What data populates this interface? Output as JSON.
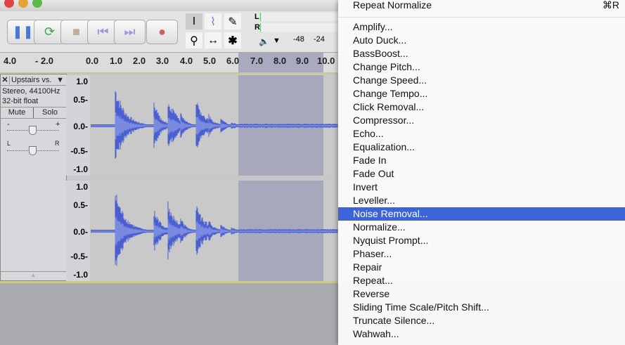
{
  "toolbar": {
    "buttons": [
      "pause",
      "loop",
      "stop",
      "skip-start",
      "skip-end",
      "record"
    ],
    "meter_labels": {
      "l": "L",
      "r": "R"
    },
    "meter_ticks": [
      "-48",
      "-24"
    ]
  },
  "ruler": {
    "ticks": [
      "4.0",
      "- 2.0",
      "0.0",
      "1.0",
      "2.0",
      "3.0",
      "4.0",
      "5.0",
      "6.0",
      "7.0",
      "8.0",
      "9.0",
      "10.0"
    ]
  },
  "track": {
    "name": "Upstairs vs.",
    "rate": "Stereo, 44100Hz",
    "format": "32-bit float",
    "mute": "Mute",
    "solo": "Solo",
    "gain_min": "-",
    "gain_max": "+",
    "pan_l": "L",
    "pan_r": "R",
    "scale": [
      "1.0",
      "0.5-",
      "0.0-",
      "-0.5-",
      "-1.0"
    ]
  },
  "menu": {
    "repeat": "Repeat Normalize",
    "repeat_shortcut": "⌘R",
    "items": [
      "Amplify...",
      "Auto Duck...",
      "BassBoost...",
      "Change Pitch...",
      "Change Speed...",
      "Change Tempo...",
      "Click Removal...",
      "Compressor...",
      "Echo...",
      "Equalization...",
      "Fade In",
      "Fade Out",
      "Invert",
      "Leveller...",
      "Noise Removal...",
      "Normalize...",
      "Nyquist Prompt...",
      "Phaser...",
      "Repair",
      "Repeat...",
      "Reverse",
      "Sliding Time Scale/Pitch Shift...",
      "Truncate Silence...",
      "Wahwah..."
    ],
    "highlighted": "Noise Removal...",
    "highlight_color": "#3b64d8"
  },
  "colors": {
    "waveform": "#4a5fd0",
    "waveform_rms": "#7a8ae0"
  }
}
